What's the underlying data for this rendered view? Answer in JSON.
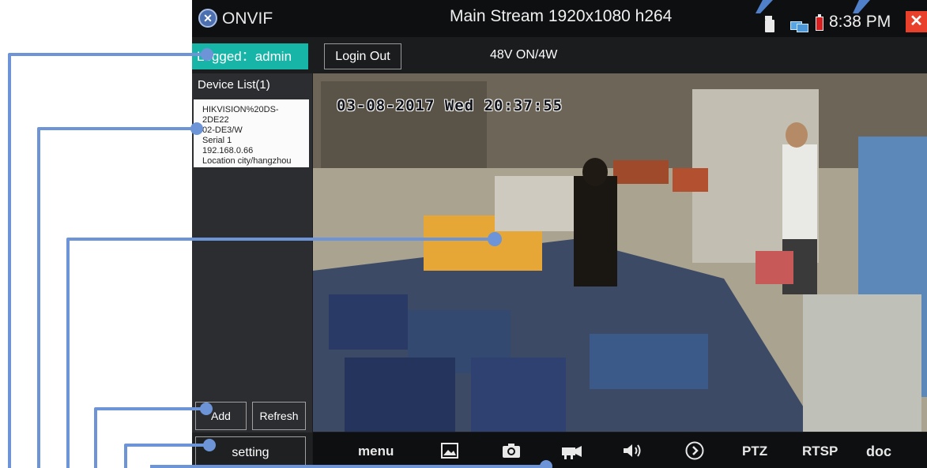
{
  "app": {
    "title": "ONVIF",
    "icon": "onvif-logo-icon"
  },
  "status_bar": {
    "stream_title": "Main Stream 1920x1080 h264",
    "time": "8:38 PM",
    "icons": [
      "sd-card-icon",
      "network-icon",
      "battery-icon"
    ],
    "close_icon": "close-icon"
  },
  "session": {
    "logged_in_label": "Logged：admin",
    "login_out_label": "Login Out",
    "power_status": "48V ON/4W"
  },
  "device_panel": {
    "title": "Device List(1)",
    "devices": [
      {
        "name_line1": "HIKVISION%20DS-2DE22",
        "name_line2": "02-DE3/W",
        "serial": "Serial 1",
        "ip": "192.168.0.66",
        "location": "Location city/hangzhou"
      }
    ],
    "add_label": "Add",
    "refresh_label": "Refresh",
    "setting_label": "setting"
  },
  "video": {
    "osd_text": "03-08-2017 Wed 20:37:55"
  },
  "toolbar": {
    "menu_label": "menu",
    "ptz_label": "PTZ",
    "rtsp_label": "RTSP",
    "doc_label": "doc",
    "icons": [
      "image-icon",
      "camera-icon",
      "record-icon",
      "volume-icon",
      "play-icon"
    ]
  },
  "colors": {
    "accent": "#17b5a7",
    "annotation": "#6d94d6",
    "close": "#e8402a",
    "background": "#1b1c1e"
  }
}
